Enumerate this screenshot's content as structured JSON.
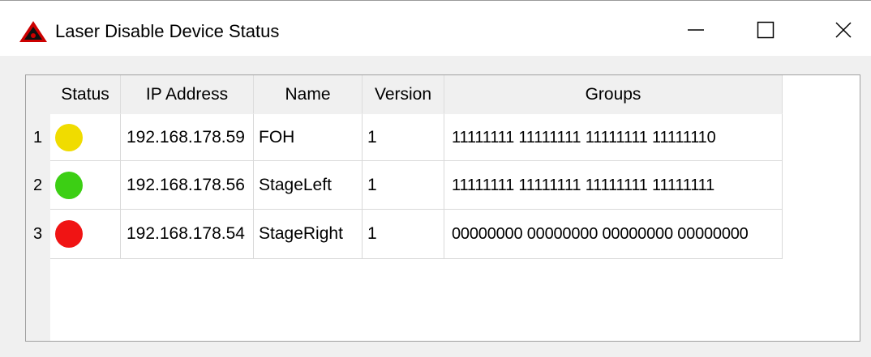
{
  "window": {
    "title": "Laser Disable Device Status",
    "icon": "laser-warning-icon",
    "controls": {
      "minimize": "minimize-icon",
      "maximize": "maximize-icon",
      "close": "close-icon"
    }
  },
  "table": {
    "columns": [
      "Status",
      "IP Address",
      "Name",
      "Version",
      "Groups"
    ],
    "rows": [
      {
        "num": "1",
        "status_color": "#f0dc00",
        "ip": "192.168.178.59",
        "name": "FOH",
        "version": "1",
        "groups": "11111111 11111111 11111111 11111110"
      },
      {
        "num": "2",
        "status_color": "#3ccf14",
        "ip": "192.168.178.56",
        "name": "StageLeft",
        "version": "1",
        "groups": "11111111 11111111 11111111 11111111"
      },
      {
        "num": "3",
        "status_color": "#f01414",
        "ip": "192.168.178.54",
        "name": "StageRight",
        "version": "1",
        "groups": "00000000 00000000 00000000 00000000"
      }
    ]
  }
}
